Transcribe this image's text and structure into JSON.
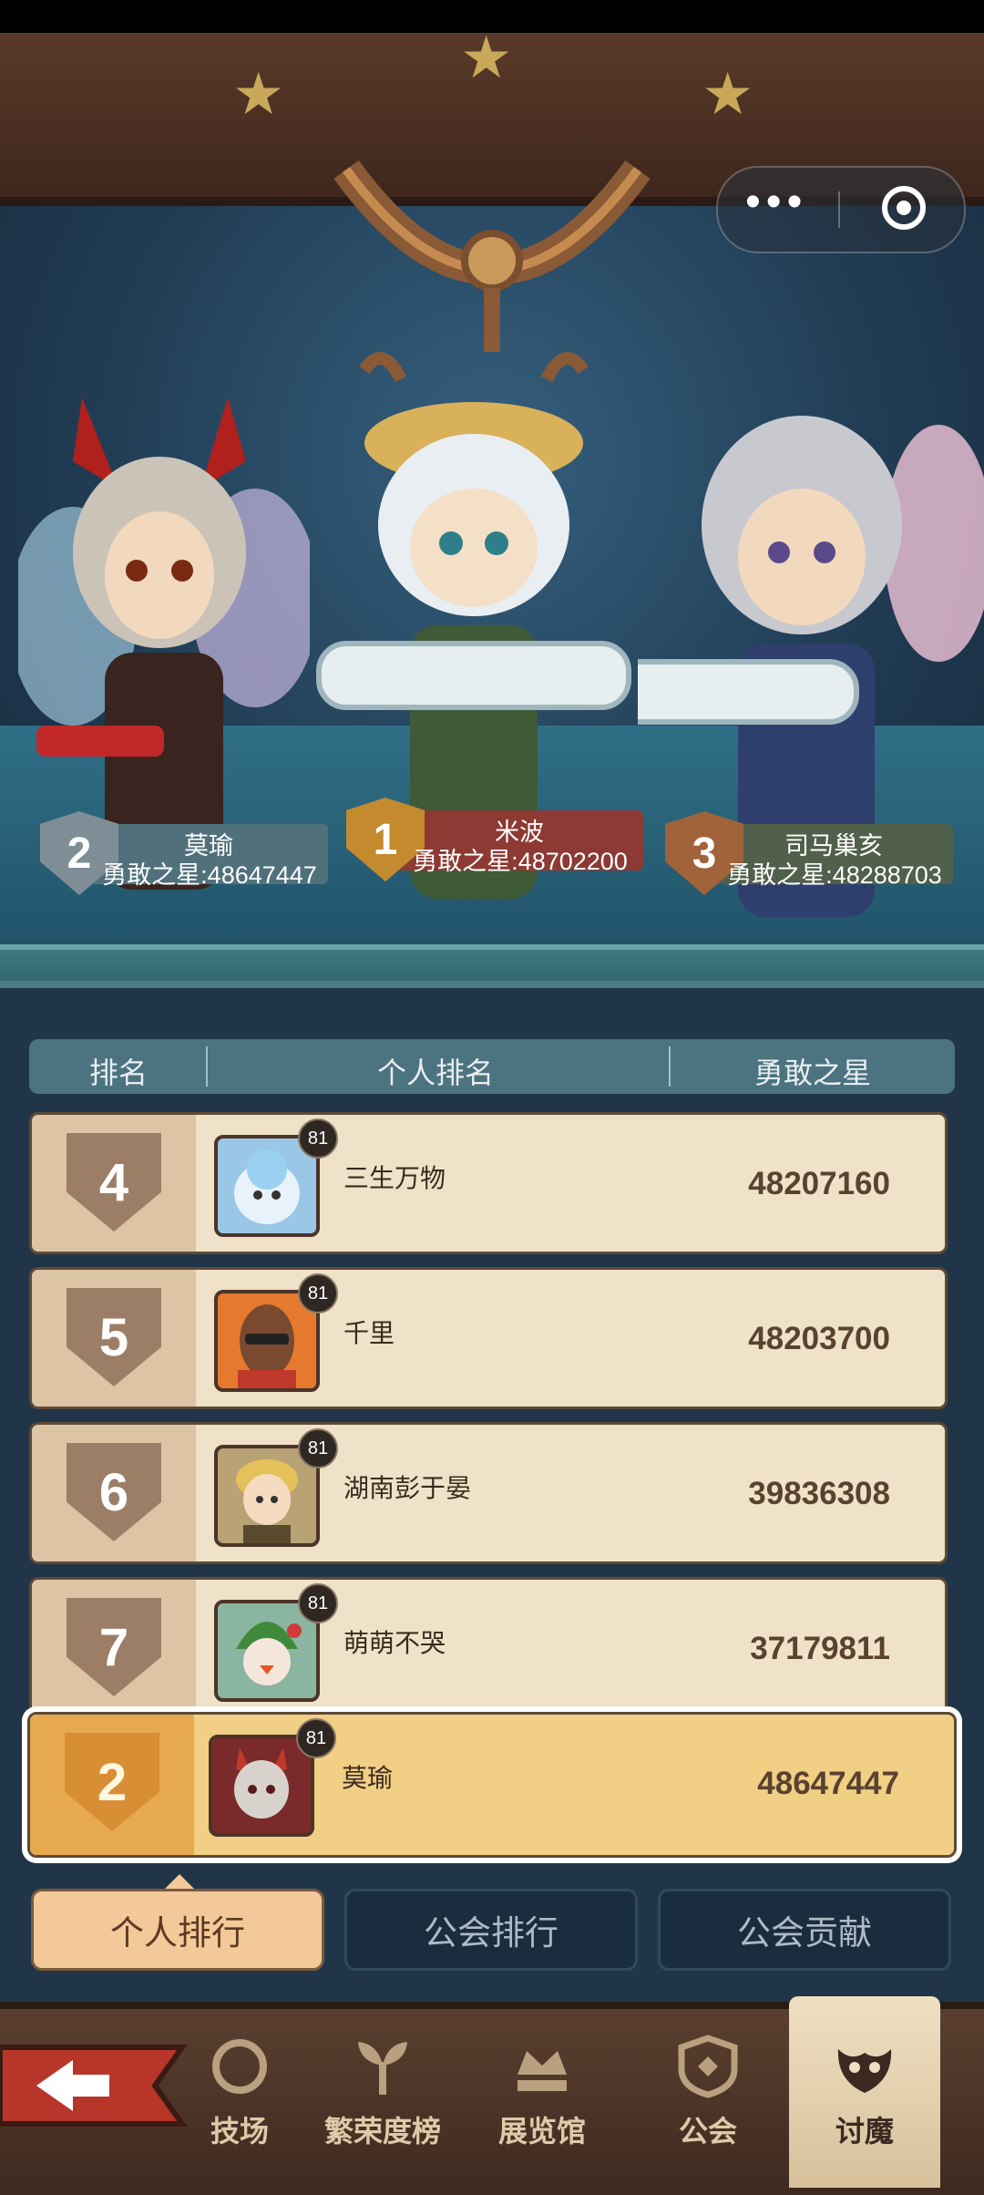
{
  "window": {
    "menu": {
      "more_icon": "ellipsis-icon",
      "close_icon": "target-icon"
    }
  },
  "podium": [
    {
      "rank": "2",
      "name": "莫瑜",
      "score": "勇敢之星:48647447"
    },
    {
      "rank": "1",
      "name": "米波",
      "score": "勇敢之星:48702200"
    },
    {
      "rank": "3",
      "name": "司马巢亥",
      "score": "勇敢之星:48288703"
    }
  ],
  "table": {
    "headers": [
      "排名",
      "个人排名",
      "勇敢之星"
    ],
    "rows": [
      {
        "rank": "4",
        "level": "81",
        "name": "三生万物",
        "score": "48207160"
      },
      {
        "rank": "5",
        "level": "81",
        "name": "千里",
        "score": "48203700"
      },
      {
        "rank": "6",
        "level": "81",
        "name": "湖南彭于晏",
        "score": "39836308"
      },
      {
        "rank": "7",
        "level": "81",
        "name": "萌萌不哭",
        "score": "37179811"
      }
    ],
    "self": {
      "rank": "2",
      "level": "81",
      "name": "莫瑜",
      "score": "48647447"
    }
  },
  "tabs": [
    "个人排行",
    "公会排行",
    "公会贡献"
  ],
  "nav": [
    "技场",
    "繁荣度榜",
    "展览馆",
    "公会",
    "讨魔"
  ],
  "colors": {
    "gold": "#b5852f",
    "silver": "#7f8e96",
    "bronze": "#a0633a",
    "panel": "#203548"
  }
}
